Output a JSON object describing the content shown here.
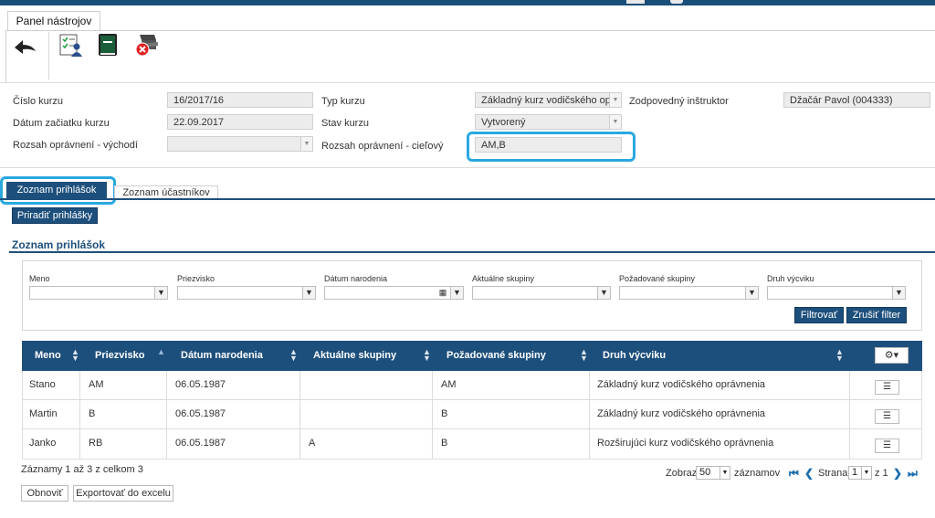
{
  "toolpanel": {
    "tab_label": "Panel nástrojov",
    "icons": [
      "back-arrow-icon",
      "approve-person-icon",
      "book-icon",
      "cancel-course-icon"
    ]
  },
  "form": {
    "cislo_kurzu_label": "Číslo kurzu",
    "cislo_kurzu_value": "16/2017/16",
    "datum_label": "Dátum začiatku kurzu",
    "datum_value": "22.09.2017",
    "rozsah_vychodzi_label": "Rozsah oprávnení - východí",
    "rozsah_vychodzi_value": "",
    "typ_kurzu_label": "Typ kurzu",
    "typ_kurzu_value": "Základný kurz vodičského opra",
    "stav_kurzu_label": "Stav kurzu",
    "stav_kurzu_value": "Vytvorený",
    "rozsah_cielovy_label": "Rozsah oprávnení - cieľový",
    "rozsah_cielovy_value": "AM,B",
    "instruktor_label": "Zodpovedný inštruktor",
    "instruktor_value": "Džačár Pavol  (004333)"
  },
  "tabs": {
    "active": "Zoznam prihlášok",
    "inactive": "Zoznam účastníkov"
  },
  "assign_button": "Priradiť prihlášky",
  "section_title": "Zoznam prihlášok",
  "filters": {
    "labels": [
      "Meno",
      "Priezvisko",
      "Dátum narodenia",
      "Aktuálne skupiny",
      "Požadované skupiny",
      "Druh výcviku"
    ],
    "filter_button": "Filtrovať",
    "clear_button": "Zrušiť filter"
  },
  "table": {
    "headers": [
      "Meno",
      "Priezvisko",
      "Dátum narodenia",
      "Aktuálne skupiny",
      "Požadované skupiny",
      "Druh výcviku"
    ],
    "rows": [
      [
        "Stano",
        "AM",
        "06.05.1987",
        "",
        "AM",
        "Základný kurz vodičského oprávnenia"
      ],
      [
        "Martin",
        "B",
        "06.05.1987",
        "",
        "B",
        "Základný kurz vodičského oprávnenia"
      ],
      [
        "Janko",
        "RB",
        "06.05.1987",
        "A",
        "B",
        "Rozširujúci kurz vodičského oprávnenia"
      ]
    ]
  },
  "footer": {
    "records_text": "Záznamy 1 až 3 z celkom 3",
    "refresh_button": "Obnoviť",
    "export_button": "Exportovať do excelu",
    "show_label": "Zobraz",
    "page_size": "50",
    "records_label": "záznamov",
    "page_label": "Strana",
    "page_value": "1",
    "page_of": "z 1"
  },
  "colors": {
    "primary": "#1d4f7c",
    "highlight": "#29a8e0"
  }
}
